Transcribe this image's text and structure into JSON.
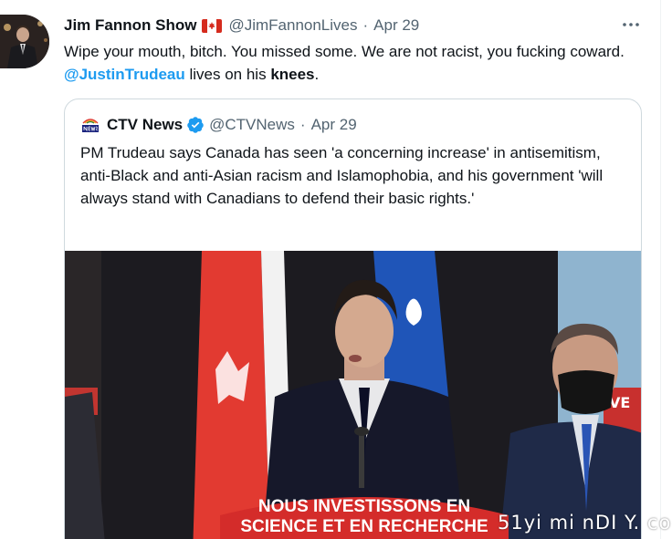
{
  "tweet": {
    "author_name": "Jim Fannon Show",
    "flag_icon": "canada-flag-icon",
    "handle": "@JimFannonLives",
    "separator": "·",
    "date": "Apr 29",
    "more_icon": "more-horizontal-icon",
    "more_label": "•••",
    "text_part1": "Wipe your mouth, bitch. You missed some. We are not racist, you fucking coward. ",
    "mention": "@JustinTrudeau",
    "text_part2": " lives on his ",
    "text_bold": "knees",
    "text_part3": "."
  },
  "quoted": {
    "author_name": "CTV News",
    "handle": "@CTVNews",
    "separator": "·",
    "date": "Apr 29",
    "verified_icon": "verified-badge-icon",
    "text": "PM Trudeau says Canada has seen 'a concerning increase' in antisemitism, anti-Black and anti-Asian racism and Islamophobia, and his government 'will always stand with Canadians to defend their basic rights.'",
    "media": {
      "podium_line1": "NOUS INVESTISSONS EN",
      "podium_line2": "SCIENCE ET EN RECHERCHE",
      "backdrop_text": "VE"
    }
  },
  "watermark": "51yi mi nDI Y. co",
  "colors": {
    "text": "#0f1419",
    "secondary": "#536471",
    "link": "#1d9bf0",
    "border": "#cfd9de",
    "verified": "#1d9bf0"
  }
}
